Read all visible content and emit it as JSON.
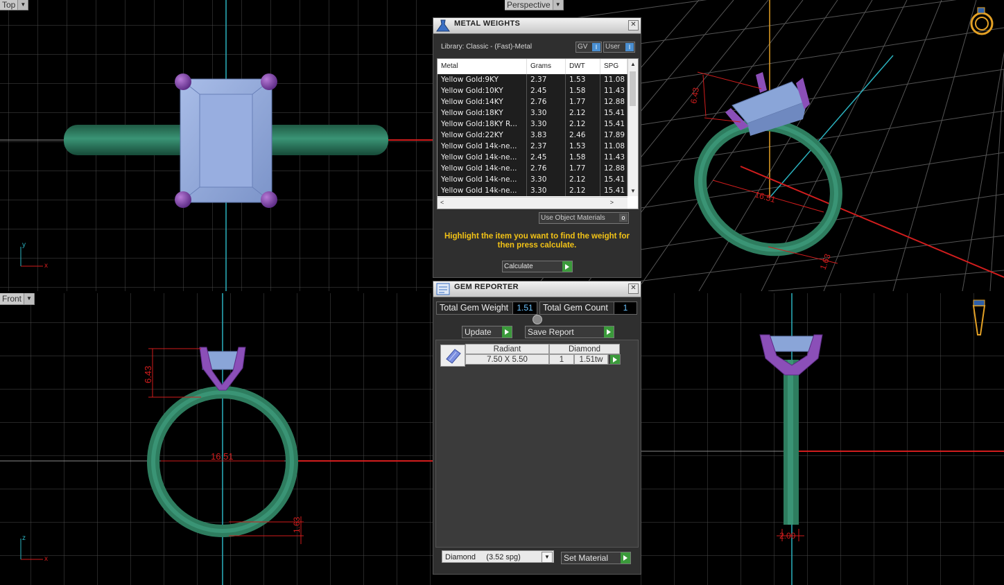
{
  "viewports": {
    "top": {
      "label": "Top",
      "axis_x": "x",
      "axis_y": "y"
    },
    "perspective": {
      "label": "Perspective",
      "dim_a": "6.43",
      "dim_b": "16.51",
      "dim_c": "1.63"
    },
    "front": {
      "label": "Front",
      "dim_height": "6.43",
      "dim_diameter": "16.51",
      "dim_shank": "1.63",
      "axis_x": "x",
      "axis_z": "z"
    },
    "side": {
      "dim_width": "2.00"
    }
  },
  "metal_weights": {
    "title": "METAL WEIGHTS",
    "library": "Library: Classic - (Fast)-Metal",
    "toggle_gv": "GV",
    "toggle_user": "User",
    "columns": [
      "Metal",
      "Grams",
      "DWT",
      "SPG"
    ],
    "rows": [
      [
        "Yellow Gold:9KY",
        "2.37",
        "1.53",
        "11.08"
      ],
      [
        "Yellow Gold:10KY",
        "2.45",
        "1.58",
        "11.43"
      ],
      [
        "Yellow Gold:14KY",
        "2.76",
        "1.77",
        "12.88"
      ],
      [
        "Yellow Gold:18KY",
        "3.30",
        "2.12",
        "15.41"
      ],
      [
        "Yellow Gold:18KY R...",
        "3.30",
        "2.12",
        "15.41"
      ],
      [
        "Yellow Gold:22KY",
        "3.83",
        "2.46",
        "17.89"
      ],
      [
        "Yellow Gold 14k-ne...",
        "2.37",
        "1.53",
        "11.08"
      ],
      [
        "Yellow Gold 14k-ne...",
        "2.45",
        "1.58",
        "11.43"
      ],
      [
        "Yellow Gold 14k-ne...",
        "2.76",
        "1.77",
        "12.88"
      ],
      [
        "Yellow Gold 14k-ne...",
        "3.30",
        "2.12",
        "15.41"
      ],
      [
        "Yellow Gold 14k-ne...",
        "3.30",
        "2.12",
        "15.41"
      ]
    ],
    "use_object_materials": "Use Object Materials",
    "hint": "Highlight the item you want to find the weight for then press calculate.",
    "calculate_label": "Calculate"
  },
  "gem_reporter": {
    "title": "GEM REPORTER",
    "total_weight_label": "Total Gem Weight",
    "total_weight_value": "1.51",
    "total_count_label": "Total Gem Count",
    "total_count_value": "1",
    "update_label": "Update",
    "save_report_label": "Save Report",
    "gem": {
      "shape": "Radiant",
      "material": "Diamond",
      "size": "7.50 X 5.50",
      "qty": "1",
      "weight": "1.51tw"
    },
    "material_select": "Diamond     (3.52 spg)",
    "set_material_label": "Set Material"
  },
  "colors": {
    "ring": "#2e7d5f",
    "prong": "#8b4fb8",
    "stone": "#8aa5d8",
    "dimension": "#e31a1a",
    "grid": "#6a6a6a"
  }
}
